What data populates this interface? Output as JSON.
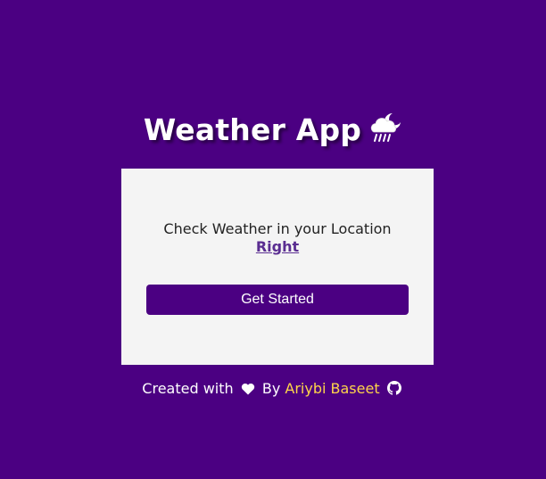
{
  "header": {
    "title": "Weather App",
    "title_icon": "cloud-rain-moon-icon"
  },
  "card": {
    "tagline_text": "Check Weather in your Location",
    "tagline_link": "Right",
    "start_button_label": "Get Started"
  },
  "footer": {
    "created_with": "Created with",
    "heart_icon": "heart-icon",
    "by_text": "By",
    "author": "Ariybi Baseet",
    "github_icon": "github-icon"
  },
  "colors": {
    "background": "#4b0082",
    "card": "#f4f4f4",
    "button": "#4b0082",
    "author_link": "#ffd54a",
    "tagline_link": "#5a2d91"
  }
}
